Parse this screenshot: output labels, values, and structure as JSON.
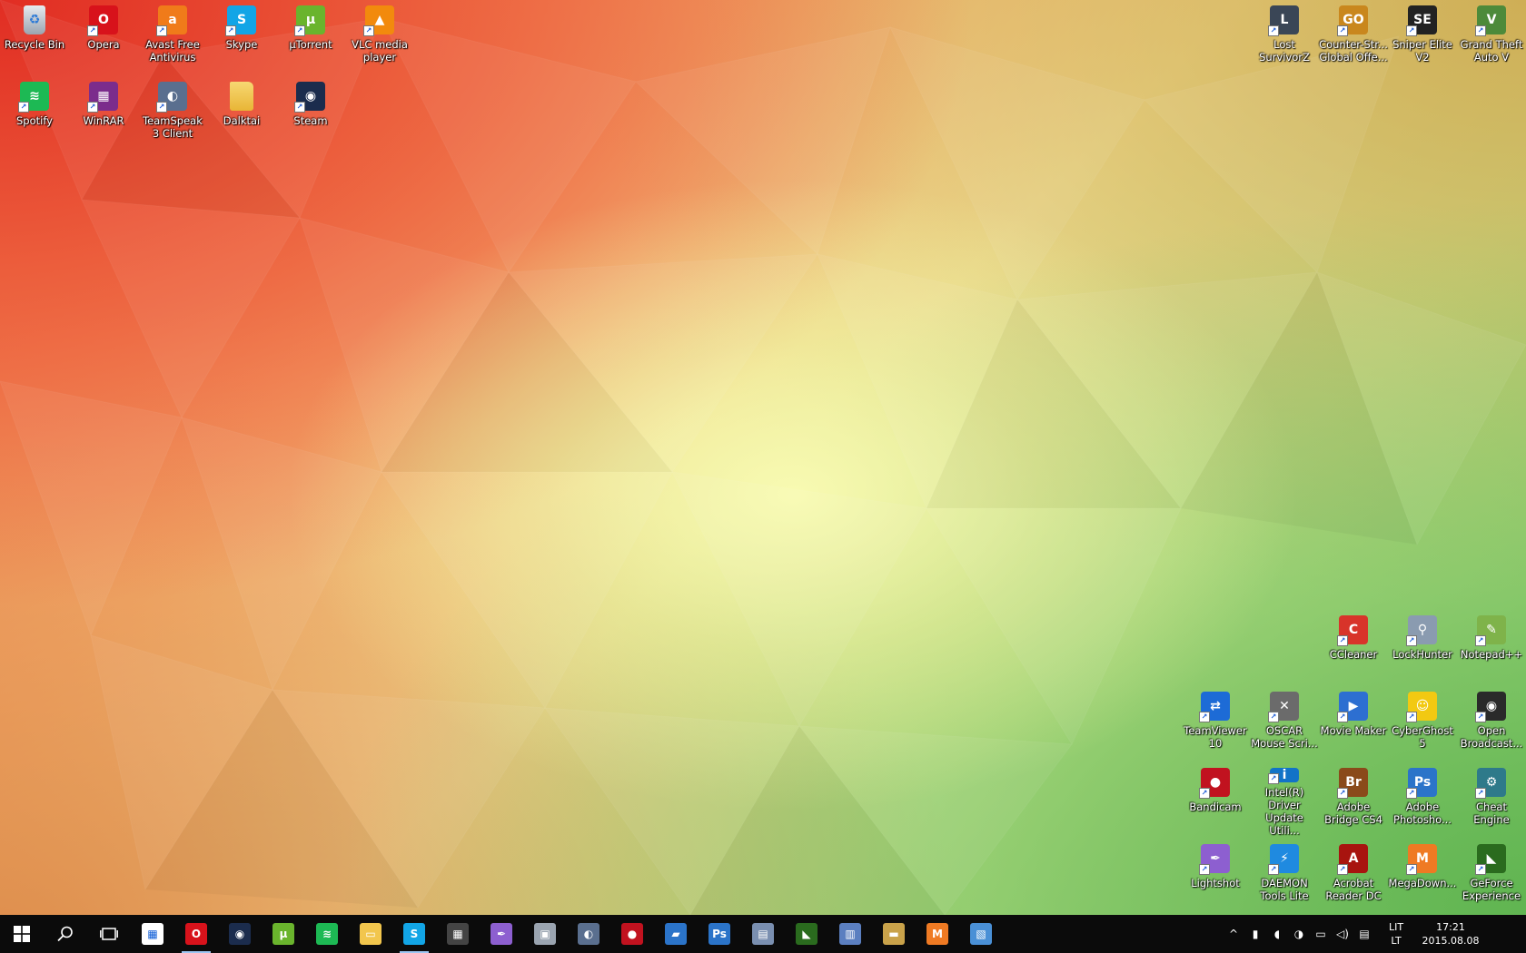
{
  "desktop": {
    "icons_top_left": [
      {
        "label": "Recycle Bin",
        "icon": "recycle-bin-icon",
        "color": "#9aa4b0",
        "glyph": "♻",
        "shortcut": false
      },
      {
        "label": "Opera",
        "icon": "opera-icon",
        "color": "#d8121b",
        "glyph": "O",
        "shortcut": true
      },
      {
        "label": "Avast Free Antivirus",
        "icon": "avast-icon",
        "color": "#f07b1a",
        "glyph": "a",
        "shortcut": true
      },
      {
        "label": "Skype",
        "icon": "skype-icon",
        "color": "#12a5e6",
        "glyph": "S",
        "shortcut": true
      },
      {
        "label": "µTorrent",
        "icon": "utorrent-icon",
        "color": "#6ab42d",
        "glyph": "µ",
        "shortcut": true
      },
      {
        "label": "VLC media player",
        "icon": "vlc-icon",
        "color": "#f28a0d",
        "glyph": "▲",
        "shortcut": true
      },
      {
        "label": "Spotify",
        "icon": "spotify-icon",
        "color": "#1db954",
        "glyph": "≋",
        "shortcut": true
      },
      {
        "label": "WinRAR",
        "icon": "winrar-icon",
        "color": "#7b2c8c",
        "glyph": "▦",
        "shortcut": true
      },
      {
        "label": "TeamSpeak 3 Client",
        "icon": "teamspeak-icon",
        "color": "#5a6f8f",
        "glyph": "◐",
        "shortcut": true
      },
      {
        "label": "Dalktai",
        "icon": "folder-icon",
        "color": "#f2c64d",
        "glyph": "",
        "shortcut": false
      },
      {
        "label": "Steam",
        "icon": "steam-icon",
        "color": "#1b2c4d",
        "glyph": "◉",
        "shortcut": true
      }
    ],
    "icons_top_right": [
      {
        "label": "Lost SurvivorZ",
        "icon": "lost-survivorz-icon",
        "color": "#3a4656",
        "glyph": "L",
        "shortcut": true
      },
      {
        "label": "Counter-Str... Global Offe...",
        "icon": "csgo-icon",
        "color": "#c9871d",
        "glyph": "GO",
        "shortcut": true
      },
      {
        "label": "Sniper Elite V2",
        "icon": "sniper-elite-icon",
        "color": "#222222",
        "glyph": "SE",
        "shortcut": true
      },
      {
        "label": "Grand Theft Auto V",
        "icon": "gta-icon",
        "color": "#4d8a3a",
        "glyph": "V",
        "shortcut": true
      }
    ],
    "icons_bottom_right": [
      {
        "label": "CCleaner",
        "icon": "ccleaner-icon",
        "color": "#d8342a",
        "glyph": "C",
        "shortcut": true
      },
      {
        "label": "LockHunter",
        "icon": "lockhunter-icon",
        "color": "#8a9bb0",
        "glyph": "⚲",
        "shortcut": true
      },
      {
        "label": "Notepad++",
        "icon": "notepadpp-icon",
        "color": "#7fb34a",
        "glyph": "✎",
        "shortcut": true
      },
      {
        "label": "TeamViewer 10",
        "icon": "teamviewer-icon",
        "color": "#1d6bd6",
        "glyph": "⇄",
        "shortcut": true
      },
      {
        "label": "OSCAR Mouse Scri...",
        "icon": "oscar-mouse-icon",
        "color": "#6b6b6b",
        "glyph": "✕",
        "shortcut": true
      },
      {
        "label": "Movie Maker",
        "icon": "movie-maker-icon",
        "color": "#2d6fd1",
        "glyph": "▶",
        "shortcut": true
      },
      {
        "label": "CyberGhost 5",
        "icon": "cyberghost-icon",
        "color": "#f2c912",
        "glyph": "☺",
        "shortcut": true
      },
      {
        "label": "Open Broadcast...",
        "icon": "obs-icon",
        "color": "#2a2a2a",
        "glyph": "◉",
        "shortcut": true
      },
      {
        "label": "Bandicam",
        "icon": "bandicam-icon",
        "color": "#c1121f",
        "glyph": "●",
        "shortcut": true
      },
      {
        "label": "Intel(R) Driver Update Utili...",
        "icon": "intel-icon",
        "color": "#1273c7",
        "glyph": "i",
        "shortcut": true
      },
      {
        "label": "Adobe Bridge CS4",
        "icon": "adobe-bridge-icon",
        "color": "#8a4a1a",
        "glyph": "Br",
        "shortcut": true
      },
      {
        "label": "Adobe Photosho...",
        "icon": "photoshop-icon",
        "color": "#2b74c9",
        "glyph": "Ps",
        "shortcut": true
      },
      {
        "label": "Cheat Engine",
        "icon": "cheat-engine-icon",
        "color": "#2e7a8a",
        "glyph": "⚙",
        "shortcut": true
      },
      {
        "label": "Lightshot",
        "icon": "lightshot-icon",
        "color": "#8d5fd0",
        "glyph": "✒",
        "shortcut": true
      },
      {
        "label": "DAEMON Tools Lite",
        "icon": "daemon-tools-icon",
        "color": "#1f8ae0",
        "glyph": "⚡",
        "shortcut": true
      },
      {
        "label": "Acrobat Reader DC",
        "icon": "acrobat-icon",
        "color": "#a8140f",
        "glyph": "A",
        "shortcut": true
      },
      {
        "label": "MegaDown...",
        "icon": "megadownloader-icon",
        "color": "#ef7a23",
        "glyph": "M",
        "shortcut": true
      },
      {
        "label": "GeForce Experience",
        "icon": "geforce-icon",
        "color": "#2a6b1e",
        "glyph": "◣",
        "shortcut": true
      }
    ]
  },
  "taskbar": {
    "start_icon": "windows-start-icon",
    "search_icon": "search-icon",
    "task_view_icon": "task-view-icon",
    "apps": [
      {
        "icon": "store-icon",
        "color": "#ffffff",
        "glyph": "▦",
        "active": false
      },
      {
        "icon": "opera-icon",
        "color": "#d8121b",
        "glyph": "O",
        "active": true
      },
      {
        "icon": "steam-icon",
        "color": "#1b2c4d",
        "glyph": "◉",
        "active": false
      },
      {
        "icon": "utorrent-icon",
        "color": "#6ab42d",
        "glyph": "µ",
        "active": false
      },
      {
        "icon": "spotify-icon",
        "color": "#1db954",
        "glyph": "≋",
        "active": false
      },
      {
        "icon": "file-explorer-icon",
        "color": "#f2c64d",
        "glyph": "▭",
        "active": false
      },
      {
        "icon": "skype-icon",
        "color": "#12a5e6",
        "glyph": "S",
        "active": true
      },
      {
        "icon": "calculator-icon",
        "color": "#444444",
        "glyph": "▦",
        "active": false
      },
      {
        "icon": "lightshot-icon",
        "color": "#8d5fd0",
        "glyph": "✒",
        "active": false
      },
      {
        "icon": "screenshot-tool-icon",
        "color": "#9aa4b0",
        "glyph": "▣",
        "active": false
      },
      {
        "icon": "teamspeak-icon",
        "color": "#5a6f8f",
        "glyph": "◐",
        "active": false
      },
      {
        "icon": "bandicam-icon",
        "color": "#c1121f",
        "glyph": "●",
        "active": false
      },
      {
        "icon": "remote-desktop-icon",
        "color": "#2b74c9",
        "glyph": "▰",
        "active": false
      },
      {
        "icon": "photoshop-icon",
        "color": "#2b74c9",
        "glyph": "Ps",
        "active": false
      },
      {
        "icon": "system-monitor-icon",
        "color": "#7a8fb0",
        "glyph": "▤",
        "active": false
      },
      {
        "icon": "geforce-icon",
        "color": "#2a6b1e",
        "glyph": "◣",
        "active": false
      },
      {
        "icon": "network-app-icon",
        "color": "#5b7fc0",
        "glyph": "▥",
        "active": false
      },
      {
        "icon": "scanner-icon",
        "color": "#c9a24a",
        "glyph": "▬",
        "active": false
      },
      {
        "icon": "megadownloader-icon",
        "color": "#ef7a23",
        "glyph": "M",
        "active": false
      },
      {
        "icon": "control-panel-icon",
        "color": "#4a90d6",
        "glyph": "▧",
        "active": false
      }
    ],
    "tray": {
      "icons": [
        {
          "icon": "show-hidden-icons-chevron-icon",
          "glyph": "^"
        },
        {
          "icon": "tray-app-red-icon",
          "glyph": "▮"
        },
        {
          "icon": "tray-app-orange-icon",
          "glyph": "◖"
        },
        {
          "icon": "tray-app-blue-icon",
          "glyph": "◑"
        },
        {
          "icon": "network-icon",
          "glyph": "▭"
        },
        {
          "icon": "volume-icon",
          "glyph": "◁)"
        },
        {
          "icon": "action-center-icon",
          "glyph": "▤"
        }
      ],
      "language_line1": "LIT",
      "language_line2": "LT",
      "time": "17:21",
      "date": "2015.08.08"
    }
  }
}
